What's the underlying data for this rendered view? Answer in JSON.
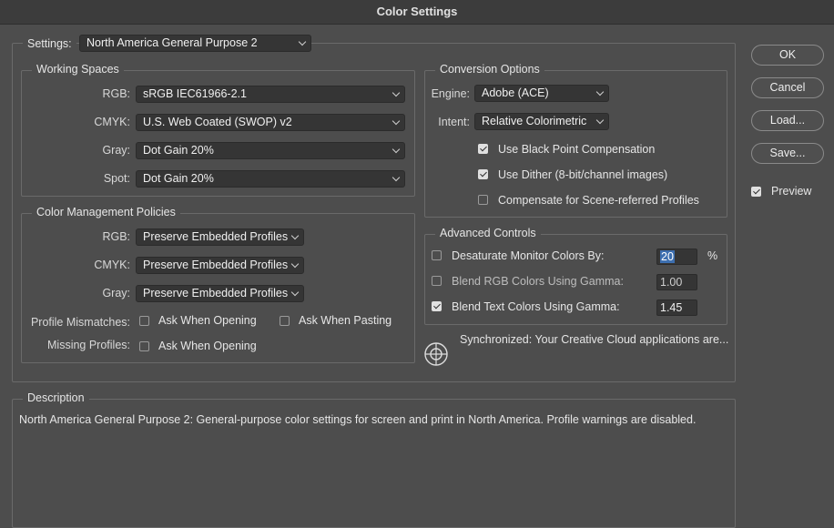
{
  "window": {
    "title": "Color Settings"
  },
  "settings": {
    "label": "Settings:",
    "value": "North America General Purpose 2"
  },
  "working_spaces": {
    "legend": "Working Spaces",
    "rgb": {
      "label": "RGB:",
      "value": "sRGB IEC61966-2.1"
    },
    "cmyk": {
      "label": "CMYK:",
      "value": "U.S. Web Coated (SWOP) v2"
    },
    "gray": {
      "label": "Gray:",
      "value": "Dot Gain 20%"
    },
    "spot": {
      "label": "Spot:",
      "value": "Dot Gain 20%"
    }
  },
  "policies": {
    "legend": "Color Management Policies",
    "rgb": {
      "label": "RGB:",
      "value": "Preserve Embedded Profiles"
    },
    "cmyk": {
      "label": "CMYK:",
      "value": "Preserve Embedded Profiles"
    },
    "gray": {
      "label": "Gray:",
      "value": "Preserve Embedded Profiles"
    },
    "mismatch_label": "Profile Mismatches:",
    "ask_opening": "Ask When Opening",
    "ask_pasting": "Ask When Pasting",
    "missing_label": "Missing Profiles:",
    "missing_ask_opening": "Ask When Opening"
  },
  "conversion": {
    "legend": "Conversion Options",
    "engine": {
      "label": "Engine:",
      "value": "Adobe (ACE)"
    },
    "intent": {
      "label": "Intent:",
      "value": "Relative Colorimetric"
    },
    "black_point": "Use Black Point Compensation",
    "dither": "Use Dither (8-bit/channel images)",
    "scene": "Compensate for Scene-referred Profiles"
  },
  "advanced": {
    "legend": "Advanced Controls",
    "desaturate": {
      "label": "Desaturate Monitor Colors By:",
      "value": "20",
      "unit": "%"
    },
    "blend_rgb": {
      "label": "Blend RGB Colors Using Gamma:",
      "value": "1.00"
    },
    "blend_text": {
      "label": "Blend Text Colors Using Gamma:",
      "value": "1.45"
    }
  },
  "sync": {
    "text": "Synchronized: Your Creative Cloud applications are..."
  },
  "description": {
    "legend": "Description",
    "text": "North America General Purpose 2:  General-purpose color settings for screen and print in North America. Profile warnings are disabled."
  },
  "buttons": {
    "ok": "OK",
    "cancel": "Cancel",
    "load": "Load...",
    "save": "Save...",
    "preview": "Preview"
  },
  "checkboxes": {
    "ask_opening": false,
    "ask_pasting": false,
    "missing_ask_opening": false,
    "black_point": true,
    "dither": true,
    "scene": false,
    "desaturate": false,
    "blend_rgb": false,
    "blend_text": true,
    "preview": true
  }
}
